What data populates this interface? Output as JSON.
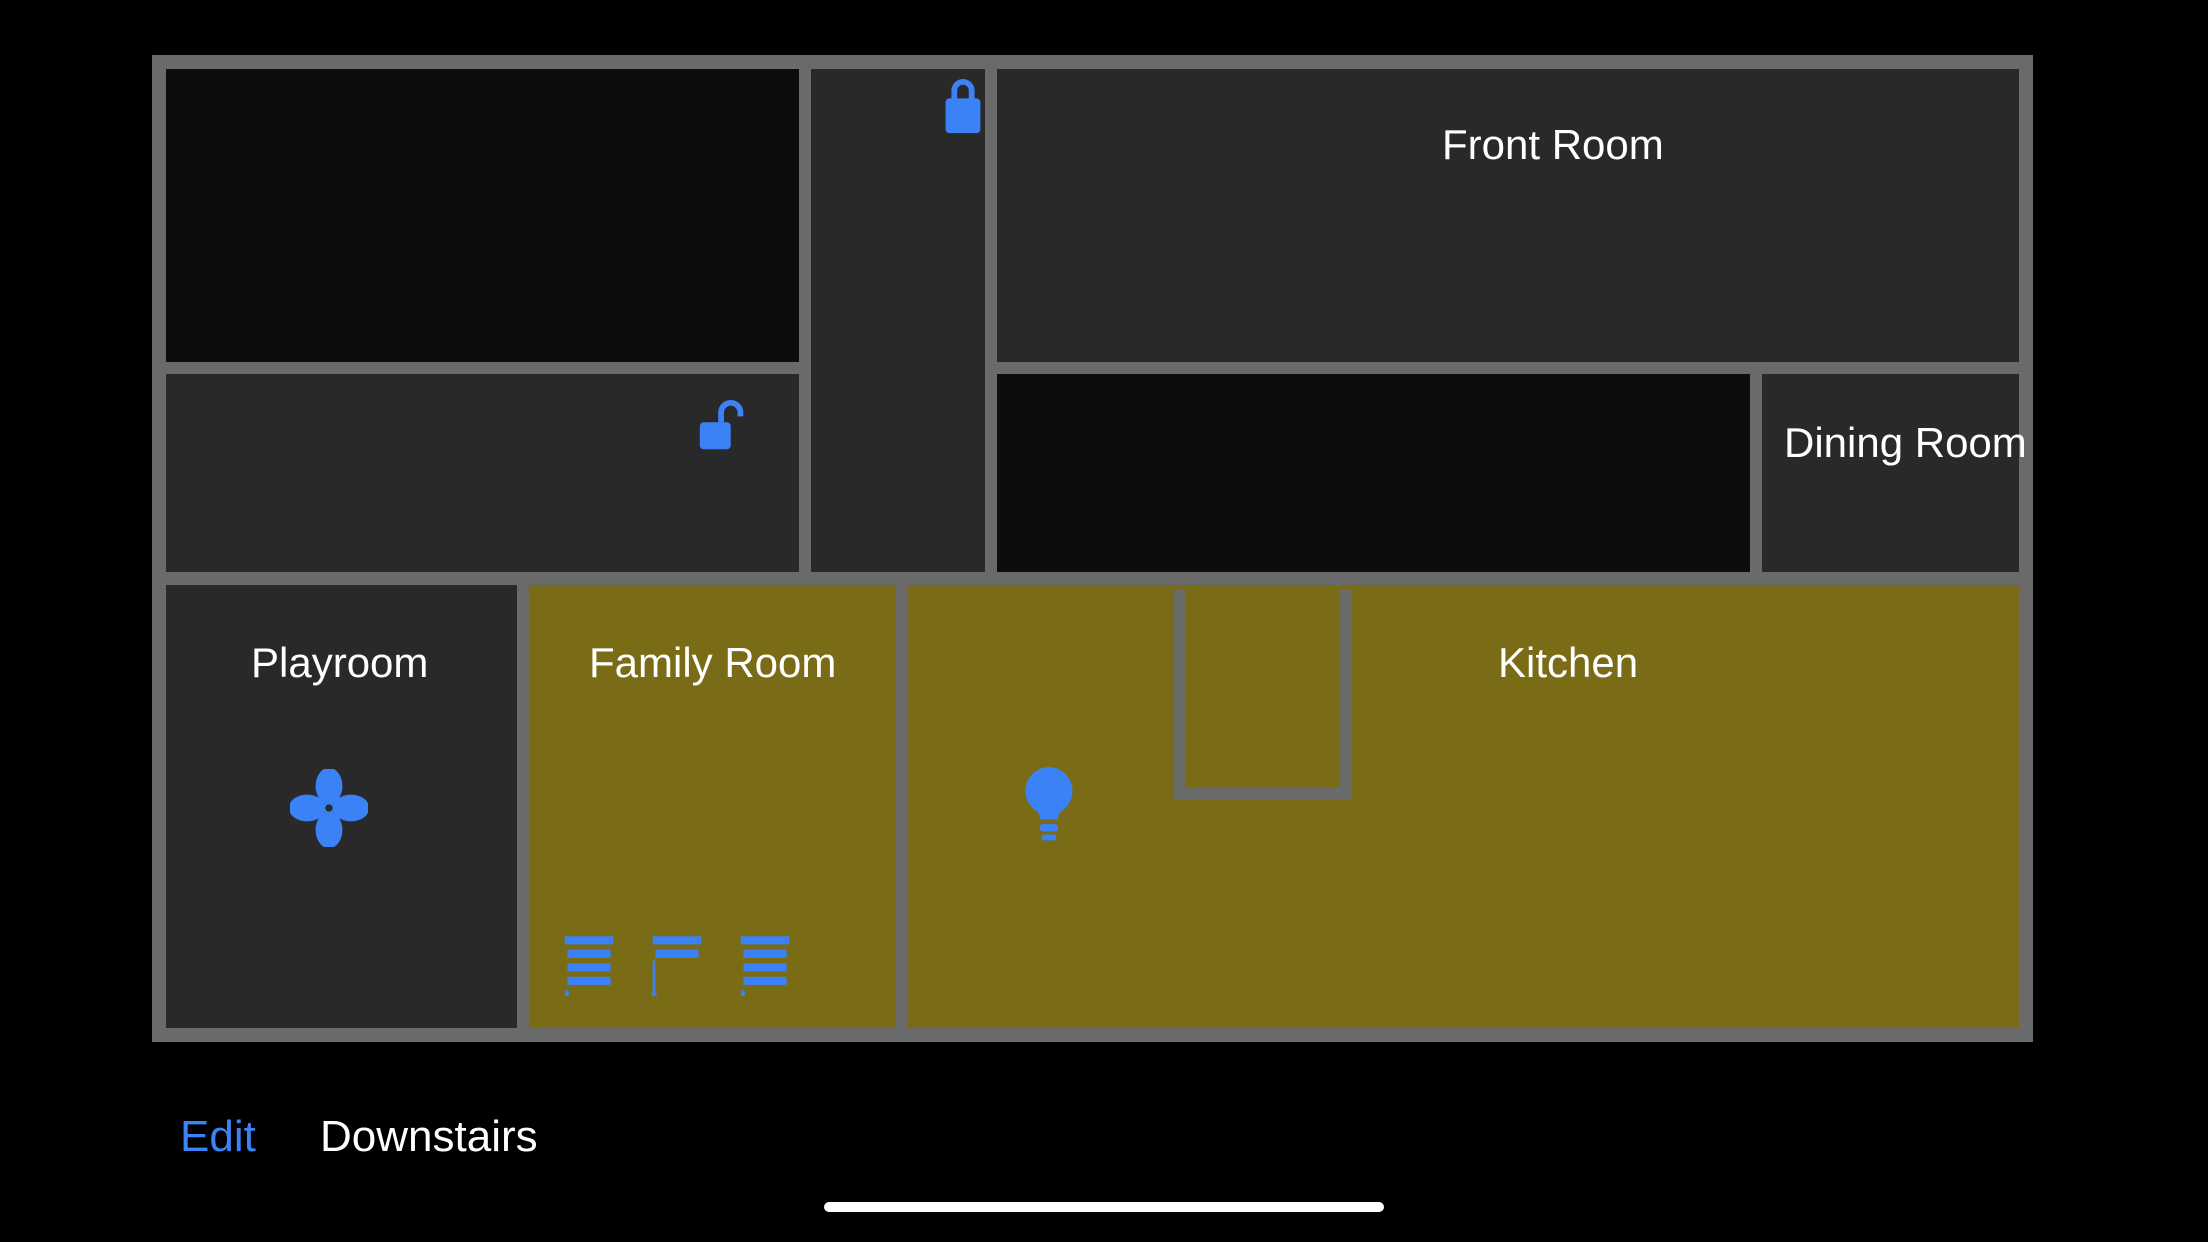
{
  "colors": {
    "accent": "#3b82f6",
    "wall": "#6a6a6a",
    "room_off": "#0c0d0e",
    "room_dark": "#292929",
    "room_lit": "#7a6b17"
  },
  "footer": {
    "edit_label": "Edit",
    "title": "Downstairs"
  },
  "rooms": {
    "front_room": {
      "label": "Front Room"
    },
    "dining_room": {
      "label": "Dining Room"
    },
    "playroom": {
      "label": "Playroom"
    },
    "family_room": {
      "label": "Family Room"
    },
    "kitchen": {
      "label": "Kitchen"
    }
  },
  "devices": {
    "lock_locked": {
      "icon": "lock-locked",
      "state": "locked"
    },
    "lock_unlocked": {
      "icon": "lock-unlocked",
      "state": "unlocked"
    },
    "fan": {
      "icon": "fan"
    },
    "bulb": {
      "icon": "lightbulb"
    },
    "blind_1": {
      "icon": "blind"
    },
    "blind_2": {
      "icon": "blind-half"
    },
    "blind_3": {
      "icon": "blind"
    }
  }
}
